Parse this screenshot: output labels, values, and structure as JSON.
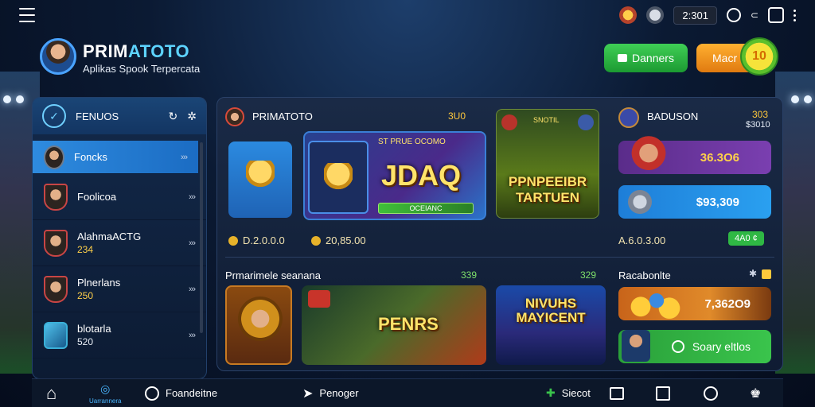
{
  "brand": {
    "title_a": "PRIM",
    "title_b": "ATOTO",
    "subtitle": "Aplikas Spook Terpercata"
  },
  "topbar": {
    "time": "2:301",
    "icons": [
      "menu-icon",
      "coin-icon",
      "settings-icon",
      "clock-icon",
      "gift-icon",
      "more-icon"
    ]
  },
  "actions": {
    "green_label": "Danners",
    "orange_label": "Macr",
    "badge": "10"
  },
  "sidebar": {
    "header": "FENUOS",
    "items": [
      {
        "label": "Foncks",
        "sub": ""
      },
      {
        "label": "Foolicoa",
        "sub": ""
      },
      {
        "label": "AlahmaACTG",
        "sub": "234"
      },
      {
        "label": "Plnerlans",
        "sub": "250"
      },
      {
        "label": "blotarla",
        "sub": "520"
      }
    ],
    "chevron": "›››"
  },
  "featured": {
    "title": "PRIMATOTO",
    "value": "3U0",
    "game1_top": "ST PRUE OCOMO",
    "game1_text": "JDAQ",
    "game1_bar": "OCEIANC",
    "game2_text_a": "PPNPEEIBR",
    "game2_text_b": "TARTUEN",
    "game2_tag": "SNOTIL",
    "coins": [
      "D.2.0.0.0",
      "20,85.00"
    ]
  },
  "right_top": {
    "title": "BADUSON",
    "value": "303",
    "value2": "$3010",
    "bar1": "36.3O6",
    "bar2": "$93,309",
    "total": "A.6.0.3.00",
    "tag": "4A0 ¢"
  },
  "lower": {
    "title": "Prmarimele seanana",
    "value": "339",
    "value2": "329",
    "game3_text": "PENRS",
    "game4_text_a": "NIVUHS",
    "game4_text_b": "MAYICENT"
  },
  "right_bottom": {
    "title": "Racabonlte",
    "bar1": "7,362O9",
    "bar2": "Soary eltlos"
  },
  "nav": {
    "home": "",
    "active_label": "Uarrannera",
    "item2": "Foandeitne",
    "item3": "Penoger",
    "item4": "Siecot"
  },
  "colors": {
    "accent": "#2e8bdf",
    "green": "#2fb844",
    "orange": "#f08c1c",
    "gold": "#ffc93c"
  }
}
